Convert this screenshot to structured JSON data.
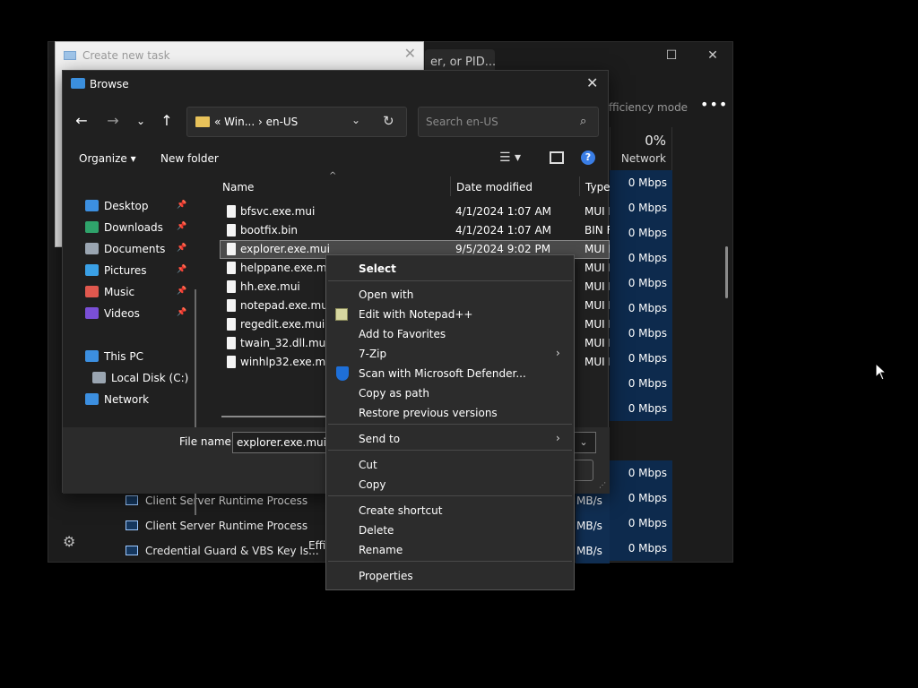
{
  "taskmanager": {
    "search_text": "er, or PID...",
    "toolbar_efficiency": "fficiency mode",
    "more": "•••",
    "network_pct": "0%",
    "network_label": "Network",
    "net_values": [
      "0 Mbps",
      "0 Mbps",
      "0 Mbps",
      "0 Mbps",
      "0 Mbps",
      "0 Mbps",
      "0 Mbps",
      "0 Mbps",
      "0 Mbps",
      "0 Mbps"
    ],
    "net_values_lower": [
      "0 Mbps",
      "0 Mbps",
      "0 Mbps",
      "0 Mbps"
    ],
    "processes": [
      {
        "name": "Client Server Runtime Process",
        "disk": "MB/s"
      },
      {
        "name": "Client Server Runtime Process",
        "disk": "MB/s"
      },
      {
        "name": "Credential Guard & VBS Key Is...",
        "disk": "MB/s"
      }
    ],
    "efficiency_cell": "Effi"
  },
  "newtask": {
    "title": "Create new task"
  },
  "browse": {
    "title": "Browse",
    "address": "Win...  ›  en-US",
    "address_prefix": "«",
    "search_placeholder": "Search en-US",
    "organize": "Organize ▾",
    "new_folder": "New folder",
    "columns": {
      "name": "Name",
      "date": "Date modified",
      "type": "Type"
    },
    "nav": [
      {
        "label": "Desktop",
        "color": "#3c8fe0",
        "pinned": true
      },
      {
        "label": "Downloads",
        "color": "#2fa36b",
        "pinned": true
      },
      {
        "label": "Documents",
        "color": "#9aa5b1",
        "pinned": true
      },
      {
        "label": "Pictures",
        "color": "#3aa0e6",
        "pinned": true
      },
      {
        "label": "Music",
        "color": "#e0584e",
        "pinned": true
      },
      {
        "label": "Videos",
        "color": "#7a4fd6",
        "pinned": true
      },
      {
        "label": "This PC",
        "color": "#3c8fe0",
        "pinned": false
      },
      {
        "label": "Local Disk (C:)",
        "color": "#9aa5b1",
        "pinned": false
      },
      {
        "label": "Network",
        "color": "#3c8fe0",
        "pinned": false
      }
    ],
    "files": [
      {
        "name": "bfsvc.exe.mui",
        "date": "4/1/2024 1:07 AM",
        "type": "MUI F"
      },
      {
        "name": "bootfix.bin",
        "date": "4/1/2024 1:07 AM",
        "type": "BIN F"
      },
      {
        "name": "explorer.exe.mui",
        "date": "9/5/2024 9:02 PM",
        "type": "MUI F"
      },
      {
        "name": "helppane.exe.mui",
        "date": "",
        "type": "MUI F"
      },
      {
        "name": "hh.exe.mui",
        "date": "",
        "type": "MUI F"
      },
      {
        "name": "notepad.exe.mui",
        "date": "",
        "type": "MUI F"
      },
      {
        "name": "regedit.exe.mui",
        "date": "",
        "type": "MUI F"
      },
      {
        "name": "twain_32.dll.mui",
        "date": "",
        "type": "MUI F"
      },
      {
        "name": "winhlp32.exe.mui",
        "date": "",
        "type": "MUI F"
      }
    ],
    "filename_label": "File name:",
    "filename_value": "explorer.exe.mui"
  },
  "context_menu": {
    "items": [
      {
        "label": "Select",
        "bold": true
      },
      {
        "label": "Open with"
      },
      {
        "label": "Edit with Notepad++"
      },
      {
        "label": "Add to Favorites"
      },
      {
        "label": "7-Zip",
        "submenu": true
      },
      {
        "label": "Scan with Microsoft Defender..."
      },
      {
        "label": "Copy as path"
      },
      {
        "label": "Restore previous versions"
      },
      {
        "label": "Send to",
        "submenu": true
      },
      {
        "label": "Cut"
      },
      {
        "label": "Copy"
      },
      {
        "label": "Create shortcut"
      },
      {
        "label": "Delete"
      },
      {
        "label": "Rename"
      },
      {
        "label": "Properties"
      }
    ]
  }
}
